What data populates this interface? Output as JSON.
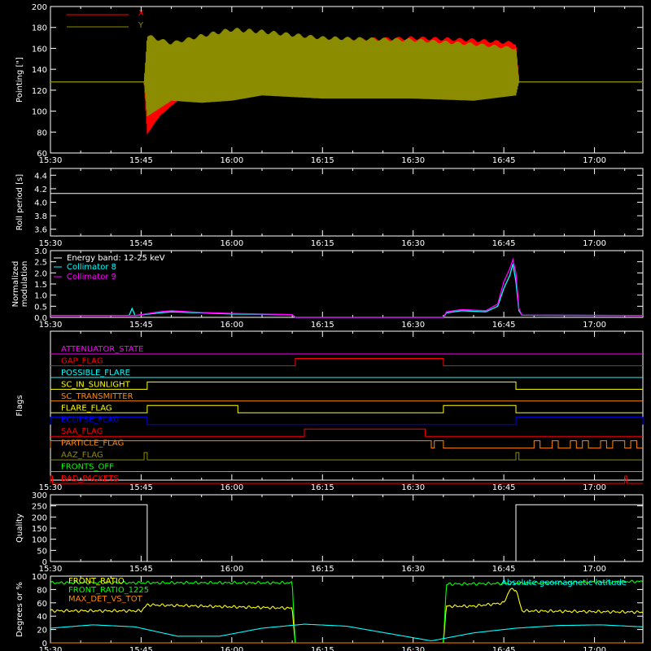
{
  "colors": {
    "background": "#000000",
    "axes": "#ffffff",
    "red": "#ff0000",
    "olive": "#8c8c00",
    "cyan": "#00ffff",
    "magenta": "#ff00ff",
    "yellow": "#ffff00",
    "orange": "#ff8800",
    "blue": "#0000ff",
    "green": "#00ff00",
    "white": "#ffffff"
  },
  "time_ticks": [
    "15:30",
    "15:45",
    "16:00",
    "16:15",
    "16:30",
    "16:45",
    "17:00"
  ],
  "chart_data": [
    {
      "type": "line",
      "ylabel": "Pointing [\"]",
      "ylim": [
        60,
        200
      ],
      "yticks": [
        60,
        80,
        100,
        120,
        140,
        160,
        180,
        200
      ],
      "xlim": [
        "15:30",
        "17:08"
      ],
      "legend": "top-left",
      "series": [
        {
          "name": "X",
          "color": "#ff0000",
          "x": [
            "15:30",
            "15:45:30",
            "15:46",
            "15:48",
            "15:52",
            "16:00",
            "16:10",
            "16:20",
            "16:30",
            "16:40",
            "16:47",
            "16:47:30",
            "17:08"
          ],
          "upper": [
            128,
            128,
            160,
            152,
            155,
            160,
            166,
            168,
            170,
            168,
            165,
            128,
            128
          ],
          "lower": [
            128,
            128,
            78,
            95,
            115,
            120,
            124,
            130,
            140,
            143,
            152,
            128,
            128
          ]
        },
        {
          "name": "Y",
          "color": "#8c8c00",
          "x": [
            "15:30",
            "15:45:30",
            "15:46",
            "15:50",
            "15:55",
            "16:00",
            "16:05",
            "16:15",
            "16:30",
            "16:40",
            "16:47",
            "16:47:30",
            "17:08"
          ],
          "upper": [
            128,
            128,
            172,
            165,
            172,
            178,
            176,
            170,
            168,
            164,
            160,
            128,
            128
          ],
          "lower": [
            128,
            128,
            95,
            110,
            108,
            110,
            115,
            112,
            112,
            110,
            115,
            128,
            128
          ]
        }
      ]
    },
    {
      "type": "line",
      "ylabel": "Roll period [s]",
      "ylim": [
        3.5,
        4.5
      ],
      "yticks": [
        3.6,
        3.8,
        4.0,
        4.2,
        4.4
      ],
      "series": [
        {
          "name": "",
          "color": "#ffffff",
          "x": [
            "15:30",
            "17:08"
          ],
          "values": [
            4.13,
            4.13
          ]
        }
      ]
    },
    {
      "type": "line",
      "ylabel": "Normalized modulation",
      "ylim": [
        0,
        3.0
      ],
      "yticks": [
        0.0,
        0.5,
        1.0,
        1.5,
        2.0,
        2.5,
        3.0
      ],
      "legend_title": "Energy band: 12-25 keV",
      "series": [
        {
          "name": "Collimator 8",
          "color": "#00ffff",
          "x": [
            "15:30",
            "15:43",
            "15:43:30",
            "15:44",
            "15:48",
            "15:50",
            "15:55",
            "16:00",
            "16:10",
            "16:10:30",
            "16:35",
            "16:35:30",
            "16:38",
            "16:42",
            "16:44",
            "16:45",
            "16:46",
            "16:46:30",
            "16:47",
            "16:47:30",
            "16:48",
            "17:08"
          ],
          "values": [
            0.08,
            0.08,
            0.4,
            0.08,
            0.2,
            0.25,
            0.2,
            0.15,
            0.12,
            0.0,
            0.0,
            0.2,
            0.3,
            0.25,
            0.5,
            1.3,
            1.9,
            2.4,
            1.6,
            0.3,
            0.1,
            0.08
          ]
        },
        {
          "name": "Collimator 9",
          "color": "#ff00ff",
          "x": [
            "15:30",
            "15:44",
            "15:48",
            "15:50",
            "15:55",
            "16:00",
            "16:10",
            "16:10:30",
            "16:35",
            "16:35:30",
            "16:38",
            "16:42",
            "16:44",
            "16:45",
            "16:46",
            "16:46:30",
            "16:47",
            "16:47:30",
            "16:48",
            "17:08"
          ],
          "values": [
            0.08,
            0.08,
            0.25,
            0.3,
            0.22,
            0.18,
            0.12,
            0.0,
            0.0,
            0.25,
            0.35,
            0.3,
            0.6,
            1.6,
            2.2,
            2.6,
            2.0,
            0.4,
            0.1,
            0.08
          ]
        }
      ]
    },
    {
      "type": "line",
      "ylabel": "Flags",
      "flags": [
        {
          "name": "ATTENUATOR_STATE",
          "color": "#ff00ff",
          "on": []
        },
        {
          "name": "GAP_FLAG",
          "color": "#ff0000",
          "on": [
            [
              "16:10:30",
              "16:35"
            ]
          ]
        },
        {
          "name": "POSSIBLE_FLARE",
          "color": "#00ffff",
          "on": []
        },
        {
          "name": "SC_IN_SUNLIGHT",
          "color": "#ffff00",
          "on": [
            [
              "15:46",
              "16:47"
            ]
          ]
        },
        {
          "name": "SC_TRANSMITTER",
          "color": "#ff8800",
          "on": []
        },
        {
          "name": "FLARE_FLAG",
          "color": "#ffff00",
          "on": [
            [
              "15:46",
              "16:01"
            ],
            [
              "16:35",
              "16:47"
            ]
          ]
        },
        {
          "name": "ECLIPSE_FLAG",
          "color": "#0000ff",
          "on": [
            [
              "15:30",
              "15:46"
            ],
            [
              "16:47",
              "17:08"
            ]
          ]
        },
        {
          "name": "SAA_FLAG",
          "color": "#ff0000",
          "on": [
            [
              "16:12",
              "16:32"
            ]
          ]
        },
        {
          "name": "PARTICLE_FLAG",
          "color": "#ff8800",
          "on": [
            [
              "15:30",
              "16:33"
            ],
            [
              "16:33:30",
              "16:35"
            ],
            [
              "16:50",
              "16:51"
            ],
            [
              "16:53",
              "16:54"
            ],
            [
              "16:56",
              "16:57"
            ],
            [
              "16:58",
              "16:59"
            ],
            [
              "17:01",
              "17:02"
            ],
            [
              "17:03",
              "17:05"
            ],
            [
              "17:06",
              "17:07"
            ]
          ]
        },
        {
          "name": "AAZ_FLAG",
          "color": "#8c8c00",
          "on": [
            [
              "15:45:30",
              "15:46"
            ],
            [
              "16:47",
              "16:47:30"
            ]
          ]
        },
        {
          "name": "FRONTS_OFF",
          "color": "#00ff00",
          "on": []
        },
        {
          "name": "BAD_PACKETS",
          "color": "#ff0000",
          "on": [
            [
              "15:30",
              "15:30:20"
            ],
            [
              "17:05",
              "17:05:20"
            ]
          ]
        }
      ]
    },
    {
      "type": "line",
      "ylabel": "Quality",
      "ylim": [
        0,
        300
      ],
      "yticks": [
        0,
        50,
        100,
        150,
        200,
        250,
        300
      ],
      "series": [
        {
          "name": "",
          "color": "#ffffff",
          "x": [
            "15:30",
            "15:46",
            "15:46",
            "16:47",
            "16:47",
            "17:08"
          ],
          "values": [
            255,
            255,
            0,
            0,
            255,
            255
          ]
        }
      ]
    },
    {
      "type": "line",
      "ylabel": "Degrees or %",
      "ylim": [
        0,
        100
      ],
      "yticks": [
        0,
        20,
        40,
        60,
        80,
        100
      ],
      "series": [
        {
          "name": "FRONT_RATIO",
          "color": "#ffff00",
          "x": [
            "15:30",
            "15:45",
            "15:46",
            "16:00",
            "16:10",
            "16:10:30",
            "16:35",
            "16:35:30",
            "16:40",
            "16:45",
            "16:46",
            "16:47",
            "16:48",
            "17:08"
          ],
          "values": [
            48,
            48,
            57,
            54,
            52,
            0,
            0,
            55,
            55,
            60,
            80,
            80,
            48,
            46
          ]
        },
        {
          "name": "FRONT_RATIO_1225",
          "color": "#00ff00",
          "x": [
            "15:30",
            "16:10",
            "16:10:30",
            "16:35",
            "16:35:30",
            "17:08"
          ],
          "values": [
            90,
            90,
            0,
            0,
            88,
            92
          ]
        },
        {
          "name": "MAX_DET_VS_TOT",
          "color": "#ff8800",
          "x": [
            "15:30",
            "17:08"
          ],
          "values": [
            0,
            0
          ]
        },
        {
          "name": "Absolute geomagnetic latitude",
          "color": "#00ffff",
          "x": [
            "15:30",
            "15:37",
            "15:44",
            "15:51",
            "15:58",
            "16:05",
            "16:12",
            "16:19",
            "16:26",
            "16:33",
            "16:40",
            "16:47",
            "16:54",
            "17:01",
            "17:08"
          ],
          "values": [
            22,
            27,
            24,
            10,
            10,
            22,
            28,
            25,
            14,
            3,
            15,
            22,
            26,
            27,
            24
          ]
        }
      ]
    }
  ]
}
